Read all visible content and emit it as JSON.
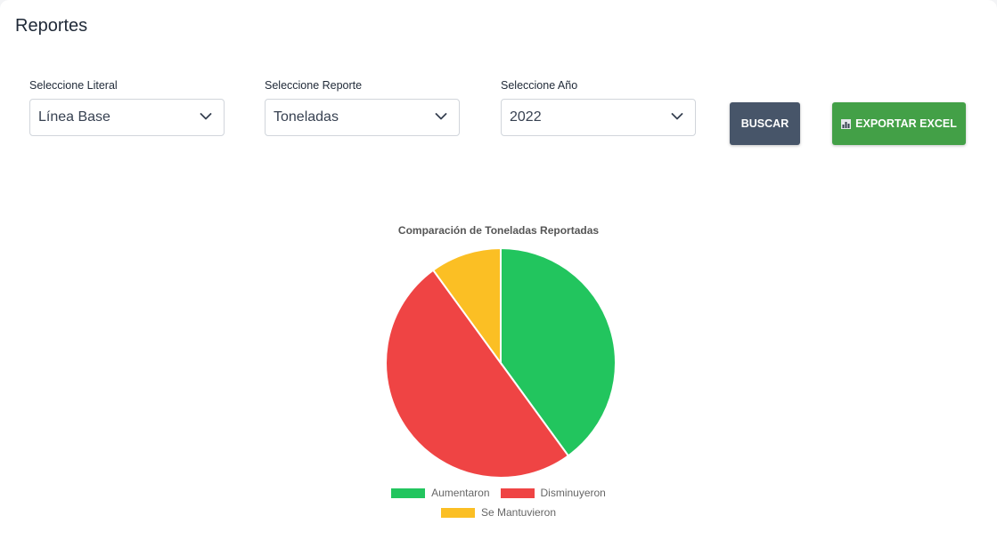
{
  "page": {
    "title": "Reportes"
  },
  "filters": {
    "literal": {
      "label": "Seleccione Literal",
      "value": "Línea Base"
    },
    "reporte": {
      "label": "Seleccione Reporte",
      "value": "Toneladas"
    },
    "anio": {
      "label": "Seleccione Año",
      "value": "2022"
    }
  },
  "buttons": {
    "buscar": {
      "label": "BUSCAR",
      "color": "#475569"
    },
    "exportar": {
      "label": "EXPORTAR EXCEL",
      "icon": "bar-chart-icon",
      "color": "#43a047"
    }
  },
  "chart_data": {
    "type": "pie",
    "title": "Comparación de Toneladas Reportadas",
    "labels": [
      "Aumentaron",
      "Disminuyeron",
      "Se Mantuvieron"
    ],
    "values": [
      40,
      50,
      10
    ],
    "colors": [
      "#22c55e",
      "#ef4444",
      "#fbbf24"
    ],
    "legend_position": "bottom"
  }
}
